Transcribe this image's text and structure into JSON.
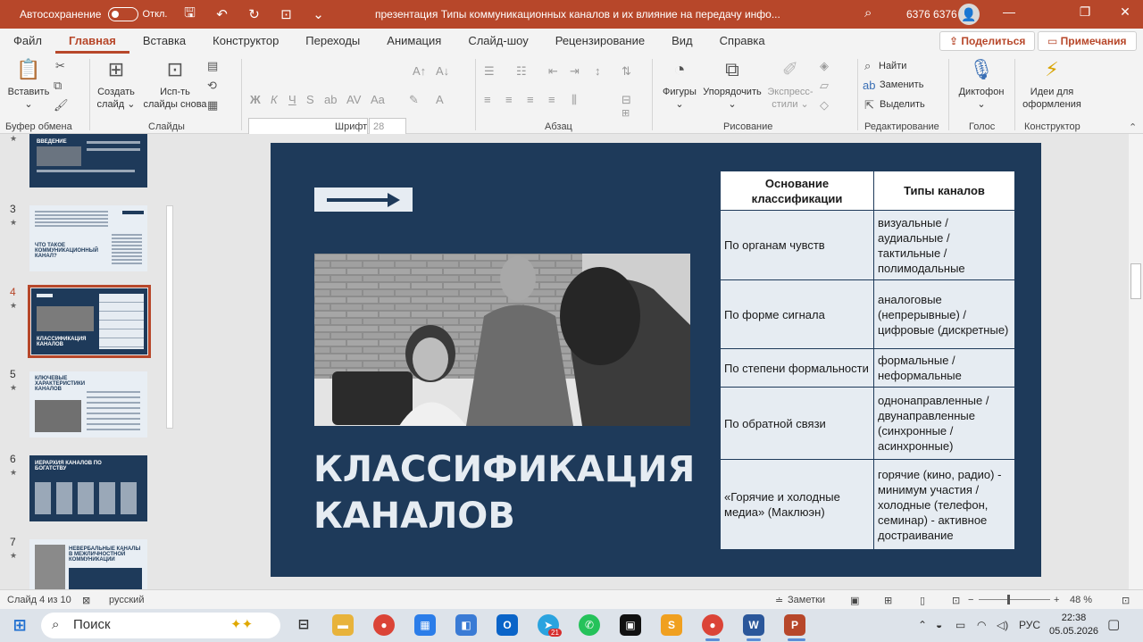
{
  "titlebar": {
    "autosave_label": "Автосохранение",
    "autosave_state": "Откл.",
    "document_title": "презентация Типы коммуникационных каналов и их влияние на передачу инфо...",
    "user_name": "6376 6376"
  },
  "tabs": [
    "Файл",
    "Главная",
    "Вставка",
    "Конструктор",
    "Переходы",
    "Анимация",
    "Слайд-шоу",
    "Рецензирование",
    "Вид",
    "Справка"
  ],
  "active_tab": "Главная",
  "share_label": "Поделиться",
  "comments_label": "Примечания",
  "ribbon": {
    "paste": "Вставить",
    "clipboard_group": "Буфер обмена",
    "new_slide_1": "Создать",
    "new_slide_2": "слайд",
    "reuse_1": "Исп-ть",
    "reuse_2": "слайды снова",
    "slides_group": "Слайды",
    "font_size": "28",
    "font_group": "Шрифт",
    "paragraph_group": "Абзац",
    "shapes": "Фигуры",
    "arrange": "Упорядочить",
    "quick_styles_1": "Экспресс-",
    "quick_styles_2": "стили",
    "drawing_group": "Рисование",
    "find": "Найти",
    "replace": "Заменить",
    "select": "Выделить",
    "editing_group": "Редактирование",
    "dictate": "Диктофон",
    "voice_group": "Голос",
    "designer_1": "Идеи для",
    "designer_2": "оформления",
    "designer_group": "Конструктор"
  },
  "thumbnails": [
    {
      "num": "",
      "title": "ВВЕДЕНИЕ"
    },
    {
      "num": "3",
      "title": "ЧТО ТАКОЕ КОММУНИКАЦИОННЫЙ КАНАЛ?"
    },
    {
      "num": "4",
      "title": "КЛАССИФИКАЦИЯ КАНАЛОВ"
    },
    {
      "num": "5",
      "title": "КЛЮЧЕВЫЕ ХАРАКТЕРИСТИКИ КАНАЛОВ"
    },
    {
      "num": "6",
      "title": "ИЕРАРХИЯ КАНАЛОВ ПО БОГАТСТВУ"
    },
    {
      "num": "7",
      "title": "НЕВЕРБАЛЬНЫЕ КАНАЛЫ В МЕЖЛИЧНОСТНОЙ КОММУНИКАЦИИ"
    }
  ],
  "slide": {
    "title": "КЛАССИФИКАЦИЯ КАНАЛОВ",
    "table": {
      "headers": [
        "Основание классификации",
        "Типы каналов"
      ],
      "rows": [
        [
          "По органам чувств",
          "визуальные / аудиальные / тактильные / полимодальные"
        ],
        [
          "По форме сигнала",
          "аналоговые (непрерывные) / цифровые (дискретные)"
        ],
        [
          "По степени формальности",
          "формальные / неформальные"
        ],
        [
          "По обратной связи",
          "однонаправленные / двунаправленные (синхронные / асинхронные)"
        ],
        [
          "«Горячие и холодные медиа» (Маклюэн)",
          "горячие (кино, радио) - минимум участия / холодные (телефон, семинар) - активное достраивание"
        ]
      ]
    }
  },
  "status": {
    "slide_counter": "Слайд 4 из 10",
    "language": "русский",
    "notes": "Заметки",
    "zoom": "48 %"
  },
  "taskbar": {
    "search": "Поиск",
    "badge": "21",
    "lang": "РУС",
    "time": "22:38",
    "date": "05.05.2026"
  },
  "colors": {
    "accent": "#b7472a",
    "slide_bg": "#1e3a5a",
    "table_bg": "#e6ecf2"
  }
}
